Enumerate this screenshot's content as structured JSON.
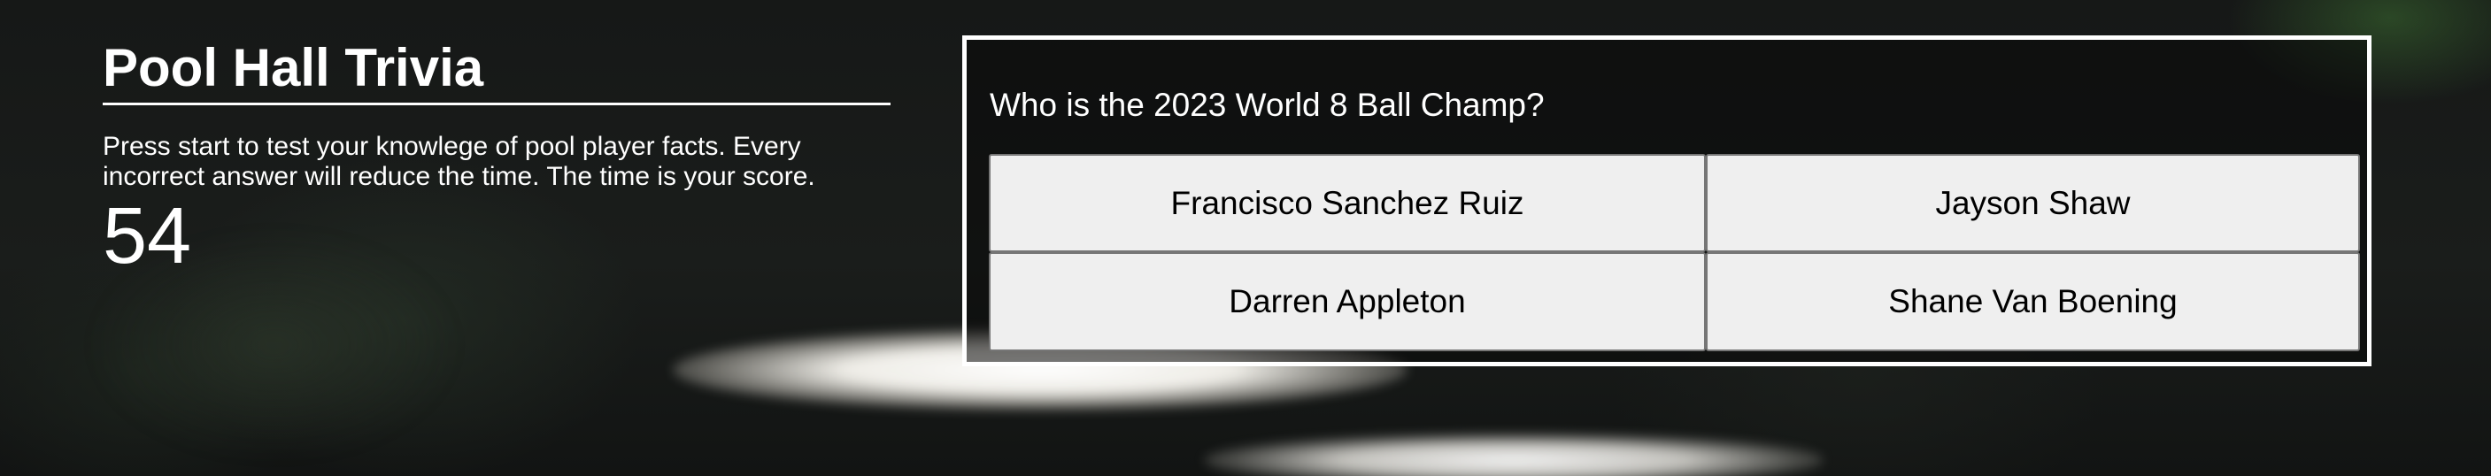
{
  "page": {
    "title": "Pool Hall Trivia",
    "intro": "Press start to test your knowlege of pool player facts. Every incorrect answer will reduce the time. The time is your score.",
    "timer": "54"
  },
  "quiz": {
    "question": "Who is the 2023 World 8 Ball Champ?",
    "answers": [
      "Francisco Sanchez Ruiz",
      "Jayson Shaw",
      "Darren Appleton",
      "Shane Van Boening"
    ]
  },
  "colors": {
    "background": "#151716",
    "text": "#ffffff",
    "button_bg": "#efefef",
    "button_border": "#767676",
    "button_text": "#000000"
  }
}
